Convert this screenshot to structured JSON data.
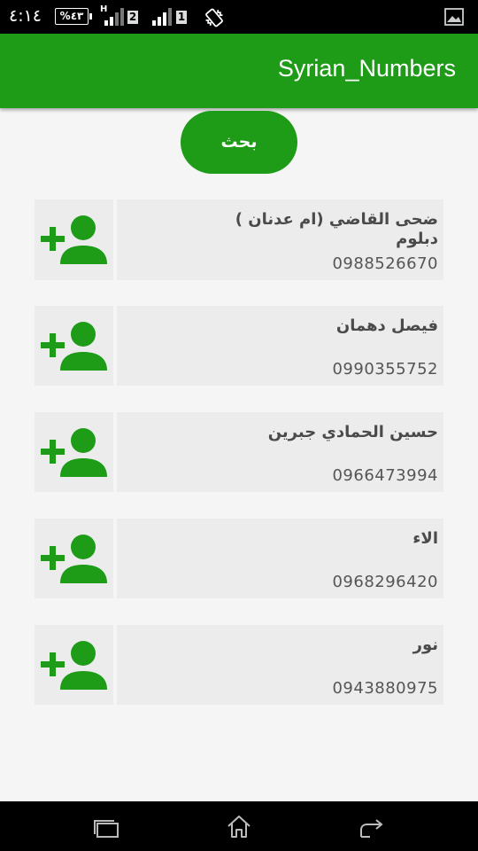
{
  "status_bar": {
    "time": "٤:١٤",
    "battery": "%٤٣",
    "network_type": "H",
    "sim1_label": "2",
    "sim2_label": "1",
    "icons": [
      "battery-icon",
      "signal-icon",
      "vibrate-icon",
      "gallery-icon"
    ]
  },
  "app_bar": {
    "title": "Syrian_Numbers"
  },
  "search": {
    "label": "بحث"
  },
  "contacts": [
    {
      "name": "ضحى القاضي (ام عدنان )\nدبلوم",
      "phone": "0988526670"
    },
    {
      "name": "فيصل دهمان",
      "phone": "0990355752"
    },
    {
      "name": "حسين الحمادي جبرين",
      "phone": "0966473994"
    },
    {
      "name": "الاء",
      "phone": "0968296420"
    },
    {
      "name": "نور",
      "phone": "0943880975"
    }
  ],
  "colors": {
    "primary": "#1e9b17",
    "row_background": "#ececec",
    "page_background": "#f5f5f5"
  },
  "nav_bar": {
    "icons": [
      "recent-apps-icon",
      "home-icon",
      "back-icon"
    ]
  }
}
